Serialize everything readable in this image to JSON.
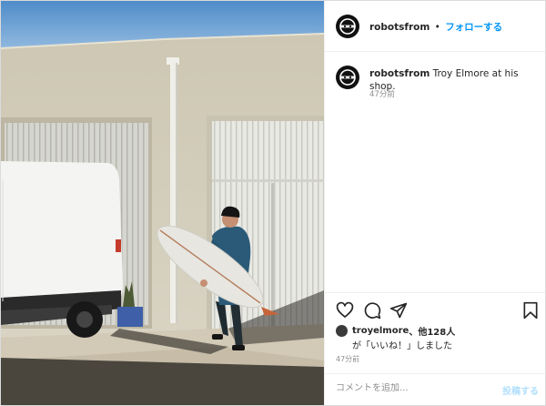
{
  "post": {
    "username": "robotsfrom",
    "separator": "•",
    "follow_label": "フォローする",
    "caption_text": "Troy Elmore at his shop.",
    "caption_time": "47分前",
    "likes_user": "troyelmore",
    "likes_others": "、他128人",
    "likes_suffix": "が「いいね！」しました",
    "post_time": "47分前",
    "comment_placeholder": "コメントを追加...",
    "post_button": "投稿する"
  },
  "icons": {
    "like": "heart-icon",
    "comment": "comment-icon",
    "share": "share-icon",
    "save": "bookmark-icon",
    "avatar": "robot-logo-icon"
  },
  "colors": {
    "follow": "#0095f6",
    "post_button_disabled": "#b2dffc",
    "meta_gray": "#8e8e8e"
  }
}
